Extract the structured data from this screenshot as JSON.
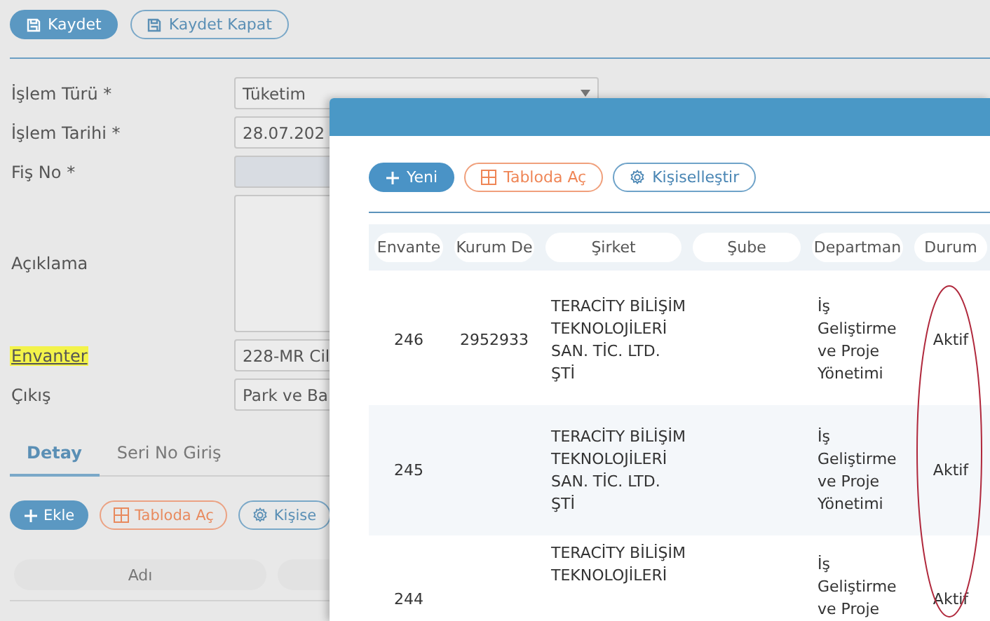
{
  "form": {
    "toolbar": [
      {
        "label": "Kaydet",
        "kind": "primary"
      },
      {
        "label": "Kaydet Kapat",
        "kind": "outline"
      }
    ],
    "fields": [
      {
        "label": "İşlem Türü *",
        "value": "Tüketim",
        "kind": "select",
        "disabled": false,
        "link": false,
        "highlighted": false
      },
      {
        "label": "İşlem Tarihi *",
        "value": "28.07.202",
        "kind": "text",
        "disabled": false,
        "link": false,
        "highlighted": false
      },
      {
        "label": "Fiş No *",
        "kind": "text",
        "disabled": true,
        "link": false,
        "highlighted": false
      },
      {
        "label": "Açıklama",
        "kind": "textarea",
        "disabled": false,
        "link": false,
        "highlighted": false
      },
      {
        "label": "Envanter",
        "value": "228-MR Cil",
        "kind": "text",
        "disabled": false,
        "link": true,
        "highlighted": true
      },
      {
        "label": "Çıkış",
        "value": "Park ve Ba",
        "kind": "text",
        "disabled": false,
        "link": false,
        "highlighted": false
      }
    ],
    "tabs": [
      {
        "label": "Detay",
        "selected": true
      },
      {
        "label": "Seri No Giriş",
        "selected": false
      }
    ],
    "detail_buttons": [
      {
        "label": "Ekle",
        "kind": "primary"
      },
      {
        "label": "Tabloda Aç",
        "kind": "orange"
      },
      {
        "label": "Kişise",
        "kind": "outline"
      }
    ],
    "detail_table": {
      "columns": [
        "Adı"
      ]
    }
  },
  "modal": {
    "buttons": [
      {
        "label": "Yeni",
        "kind": "primary"
      },
      {
        "label": "Tabloda Aç",
        "kind": "orange"
      },
      {
        "label": "Kişiselleştir",
        "kind": "outline"
      }
    ],
    "table": {
      "columns": [
        "Envante",
        "Kurum De",
        "Şirket",
        "Şube",
        "Departman",
        "Durum"
      ],
      "rows": [
        {
          "envanter": "246",
          "kurum": "2952933",
          "sirket": "TERACİTY BİLİŞİM TEKNOLOJİLERİ SAN. TİC. LTD. ŞTİ",
          "departman": "İş Geliştirme ve Proje Yönetimi",
          "durum": "Aktif"
        },
        {
          "envanter": "245",
          "sirket": "TERACİTY BİLİŞİM TEKNOLOJİLERİ SAN. TİC. LTD. ŞTİ",
          "departman": "İş Geliştirme ve Proje Yönetimi",
          "durum": "Aktif"
        },
        {
          "envanter": "244",
          "sirket": "TERACİTY BİLİŞİM TEKNOLOJİLERİ",
          "departman": "İş Geliştirme ve Proje",
          "durum": "Aktif"
        }
      ]
    }
  }
}
